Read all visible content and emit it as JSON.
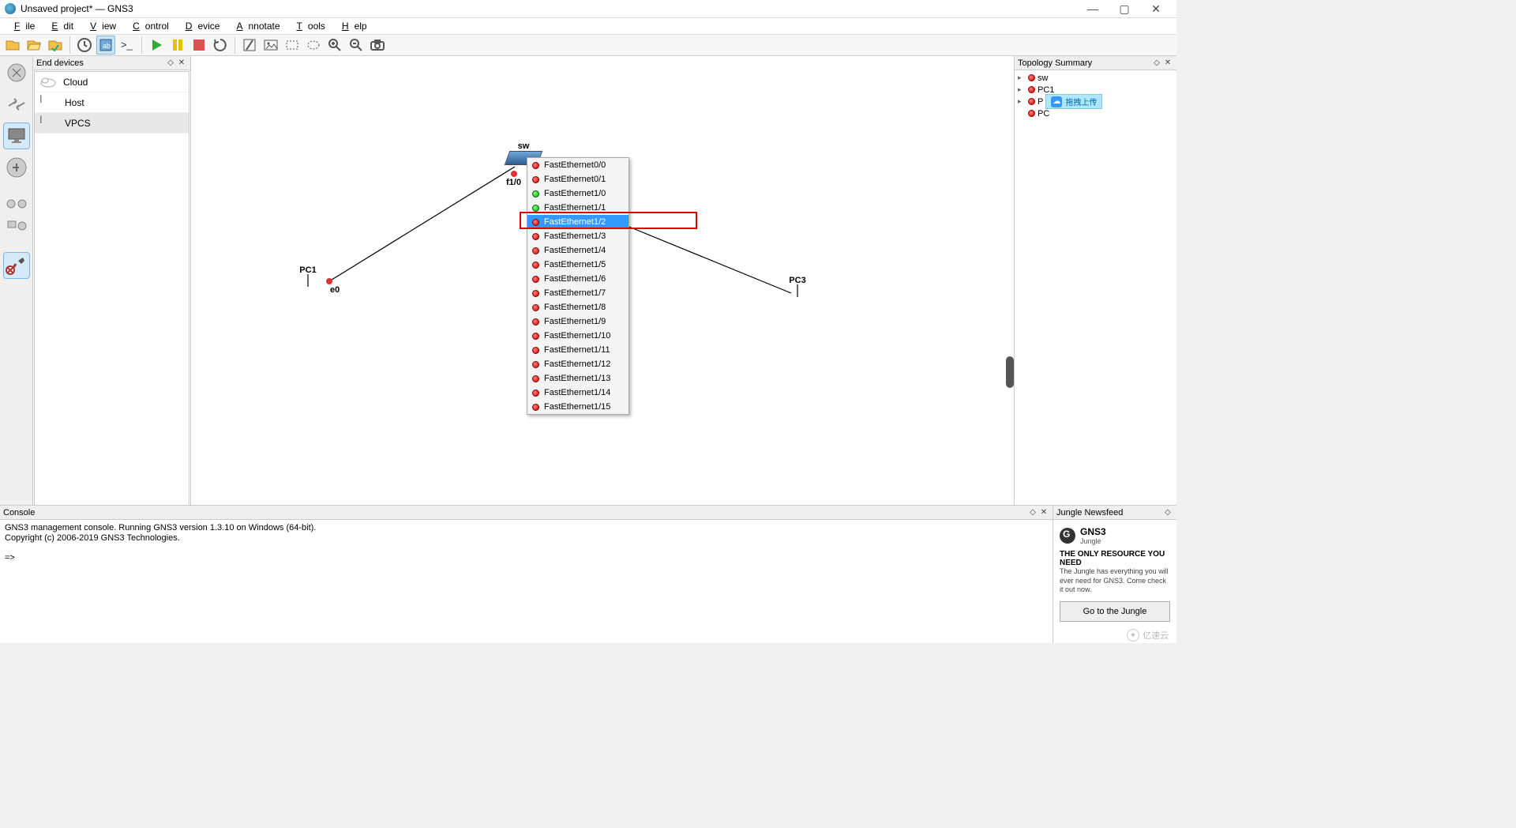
{
  "window": {
    "title": "Unsaved project* — GNS3",
    "controls": {
      "min": "—",
      "max": "▢",
      "close": "✕"
    }
  },
  "menu": {
    "items": [
      "File",
      "Edit",
      "View",
      "Control",
      "Device",
      "Annotate",
      "Tools",
      "Help"
    ]
  },
  "dock": {
    "title": "End devices",
    "items": [
      "Cloud",
      "Host",
      "VPCS"
    ],
    "selected": "VPCS"
  },
  "canvas": {
    "sw_label": "sw",
    "pc1_label": "PC1",
    "pc3_label": "PC3",
    "port_f10": "f1/0",
    "port_e0": "e0"
  },
  "context_menu": {
    "items": [
      {
        "label": "FastEthernet0/0",
        "green": false
      },
      {
        "label": "FastEthernet0/1",
        "green": false
      },
      {
        "label": "FastEthernet1/0",
        "green": true
      },
      {
        "label": "FastEthernet1/1",
        "green": true
      },
      {
        "label": "FastEthernet1/2",
        "green": false,
        "highlight": true
      },
      {
        "label": "FastEthernet1/3",
        "green": false
      },
      {
        "label": "FastEthernet1/4",
        "green": false
      },
      {
        "label": "FastEthernet1/5",
        "green": false
      },
      {
        "label": "FastEthernet1/6",
        "green": false
      },
      {
        "label": "FastEthernet1/7",
        "green": false
      },
      {
        "label": "FastEthernet1/8",
        "green": false
      },
      {
        "label": "FastEthernet1/9",
        "green": false
      },
      {
        "label": "FastEthernet1/10",
        "green": false
      },
      {
        "label": "FastEthernet1/11",
        "green": false
      },
      {
        "label": "FastEthernet1/12",
        "green": false
      },
      {
        "label": "FastEthernet1/13",
        "green": false
      },
      {
        "label": "FastEthernet1/14",
        "green": false
      },
      {
        "label": "FastEthernet1/15",
        "green": false
      }
    ]
  },
  "topology": {
    "title": "Topology Summary",
    "rows": [
      "sw",
      "PC1",
      "P",
      "PC"
    ],
    "badge": "拖拽上传"
  },
  "console": {
    "title": "Console",
    "line1": "GNS3 management console. Running GNS3 version 1.3.10 on Windows (64-bit).",
    "line2": "Copyright (c) 2006-2019 GNS3 Technologies.",
    "prompt": "=>"
  },
  "news": {
    "title": "Jungle Newsfeed",
    "logo_title": "GNS3",
    "logo_sub": "Jungle",
    "headline": "THE ONLY RESOURCE YOU NEED",
    "text": "The Jungle has everything you will ever need for GNS3. Come check it out now.",
    "button": "Go to the Jungle"
  },
  "watermark": "亿速云"
}
